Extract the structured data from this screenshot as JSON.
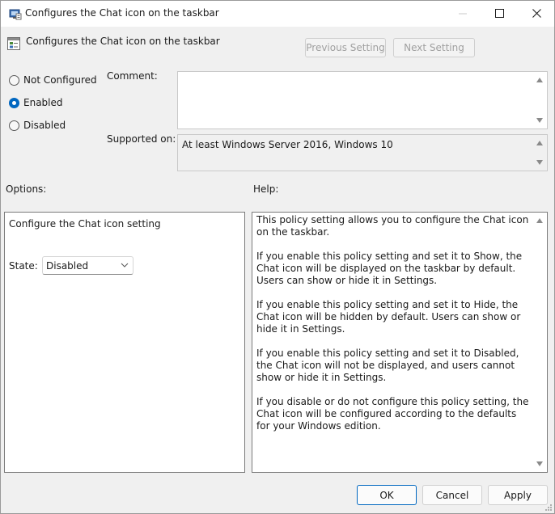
{
  "window": {
    "title": "Configures the Chat icon on the taskbar"
  },
  "header": {
    "title": "Configures the Chat icon on the taskbar",
    "previous_label": "Previous Setting",
    "next_label": "Next Setting"
  },
  "state_options": [
    {
      "label": "Not Configured",
      "selected": false
    },
    {
      "label": "Enabled",
      "selected": true
    },
    {
      "label": "Disabled",
      "selected": false
    }
  ],
  "comment": {
    "label": "Comment:",
    "value": ""
  },
  "supported": {
    "label": "Supported on:",
    "value": "At least Windows Server 2016, Windows 10"
  },
  "options": {
    "label": "Options:",
    "setting_title": "Configure the Chat icon setting",
    "state_label": "State:",
    "state_value": "Disabled"
  },
  "help": {
    "label": "Help:",
    "paragraphs": [
      "This policy setting allows you to configure the Chat icon on the taskbar.",
      "If you enable this policy setting and set it to Show, the Chat icon will be displayed on the taskbar by default. Users can show or hide it in Settings.",
      "If you enable this policy setting and set it to Hide, the Chat icon will be hidden by default. Users can show or hide it in Settings.",
      "If you enable this policy setting and set it to Disabled, the Chat icon will not be displayed, and users cannot show or hide it in Settings.",
      "If you disable or do not configure this policy setting, the Chat icon will be configured according to the defaults for your Windows edition."
    ]
  },
  "buttons": {
    "ok": "OK",
    "cancel": "Cancel",
    "apply": "Apply"
  },
  "icons": {
    "title": "policy-editor-icon",
    "header": "policy-setting-icon"
  },
  "colors": {
    "accent": "#0067c0"
  }
}
